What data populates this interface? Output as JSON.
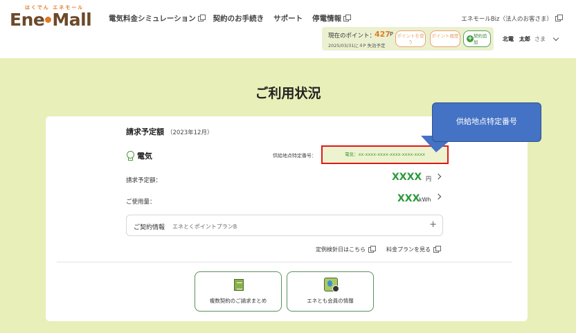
{
  "brand": {
    "kana": "はくでん エネモール",
    "name_left": "Ene",
    "name_right": "Mall"
  },
  "nav": [
    {
      "label": "電気料金シミュレーション",
      "external": true
    },
    {
      "label": "契約のお手続き",
      "external": false
    },
    {
      "label": "サポート",
      "external": false
    },
    {
      "label": "停電情報",
      "external": true
    }
  ],
  "biz_link": "エネモールBiz（法人のお客さま）",
  "points": {
    "label": "現在のポイント：",
    "value": "427",
    "unit": "P",
    "expire": "2025/03/31に４P 失効予定",
    "use_label": "ポイントを使う",
    "history_label": "ポイント履歴",
    "add_label": "契約追加"
  },
  "user": {
    "name": "北電　太郎",
    "honorific": "さま"
  },
  "page_title": "ご利用状況",
  "billing": {
    "heading": "請求予定額",
    "period": "（2023年12月）",
    "service": "電気",
    "supply_point_label": "供給地点特定番号：",
    "supply_point_value": "電気：xx-xxxx-xxxx-xxxx-xxxx-xxxx",
    "amount_label": "請求予定額：",
    "amount_value": "XXXX",
    "amount_unit": "円",
    "usage_label": "ご使用量：",
    "usage_value": "XXX",
    "usage_unit": "kWh"
  },
  "contract": {
    "title": "ご契約情報",
    "plan": "エネとくポイントプランB"
  },
  "links": {
    "meter_day": "定例検針日はこちら",
    "price_plan": "料金プランを見る"
  },
  "tiles": {
    "bulk_billing": "複数契約のご請求まとめ",
    "member_info": "エネとも会員の情報"
  },
  "callout": "供給地点特定番号",
  "colors": {
    "accent_green": "#2a9a3a",
    "accent_orange": "#e07b24",
    "page_bg": "#e8efb8",
    "callout_blue": "#4472c4",
    "highlight_red": "#e01818"
  }
}
